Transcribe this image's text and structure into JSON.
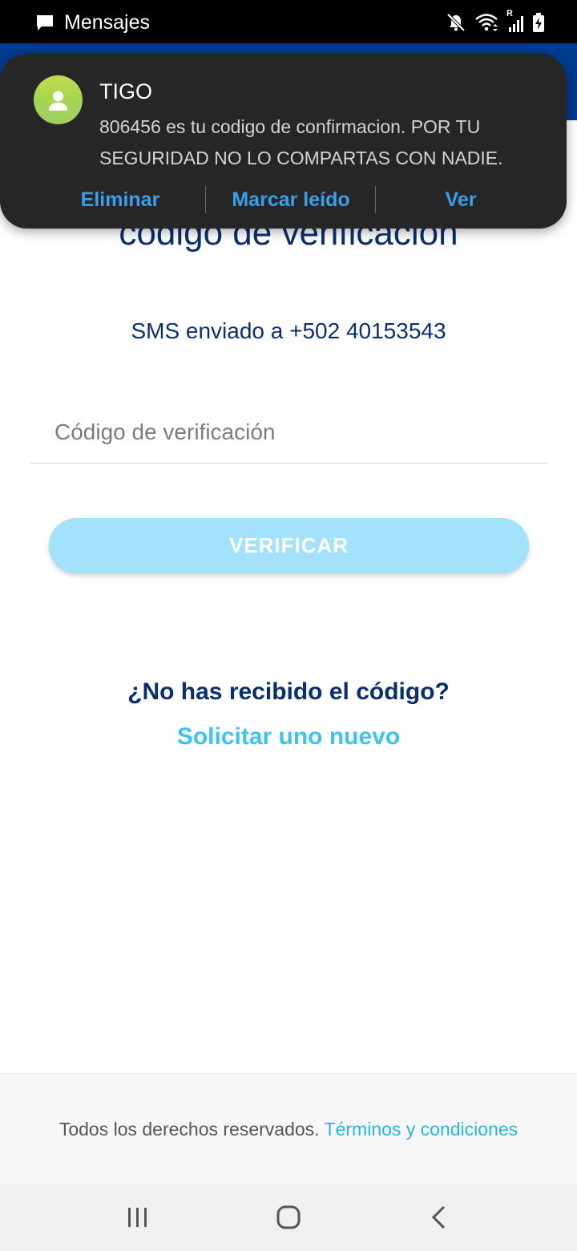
{
  "status_bar": {
    "app_label": "Mensajes",
    "icons": [
      "message-icon",
      "mute-icon",
      "wifi-icon",
      "signal-icon",
      "battery-charging-icon"
    ],
    "roaming_indicator": "R"
  },
  "notification": {
    "sender": "TIGO",
    "message": "806456 es tu codigo de confirmacion. POR TU SEGURIDAD NO LO COMPARTAS CON NADIE.",
    "actions": {
      "delete": "Eliminar",
      "mark_read": "Marcar leído",
      "view": "Ver"
    },
    "action_color": "#3aa0e8"
  },
  "main": {
    "title": "código de verificación",
    "sms_info": "SMS enviado a +502 40153543",
    "code_input": {
      "placeholder": "Código de verificación",
      "value": ""
    },
    "verify_button": "VERIFICAR",
    "no_code_text": "¿No has recibido el código?",
    "request_new": "Solicitar uno nuevo"
  },
  "footer": {
    "rights_text": "Todos los derechos reservados.",
    "terms_link": "Términos y condiciones"
  },
  "colors": {
    "primary_dark": "#0a2f6e",
    "accent": "#3ec3ef",
    "button_disabled": "#a3e2fa",
    "header": "#003b8e"
  }
}
